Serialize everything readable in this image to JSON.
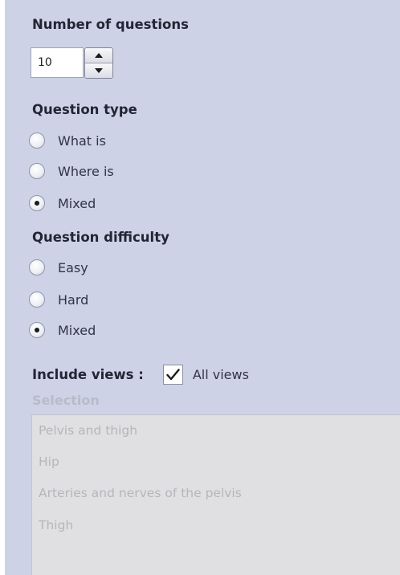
{
  "number_of_questions": {
    "heading": "Number of questions",
    "value": "10"
  },
  "question_type": {
    "heading": "Question type",
    "options": [
      {
        "label": "What is",
        "checked": false
      },
      {
        "label": "Where is",
        "checked": false
      },
      {
        "label": "Mixed",
        "checked": true
      }
    ]
  },
  "question_difficulty": {
    "heading": "Question difficulty",
    "options": [
      {
        "label": "Easy",
        "checked": false
      },
      {
        "label": "Hard",
        "checked": false
      },
      {
        "label": "Mixed",
        "checked": true
      }
    ]
  },
  "include_views": {
    "label": "Include views :",
    "all_views_label": "All views",
    "all_views_checked": true
  },
  "selection": {
    "label": "Selection",
    "items": [
      "Pelvis and thigh",
      "Hip",
      "Arteries and nerves of the pelvis",
      "Thigh"
    ]
  },
  "colors": {
    "panel_background": "#cdd2e7",
    "list_background": "#e0e0e2",
    "disabled_text": "#b4b6bd"
  },
  "icons": {
    "stepper_up": "triangle-up-icon",
    "stepper_down": "triangle-down-icon",
    "checkbox": "checkmark-icon"
  }
}
